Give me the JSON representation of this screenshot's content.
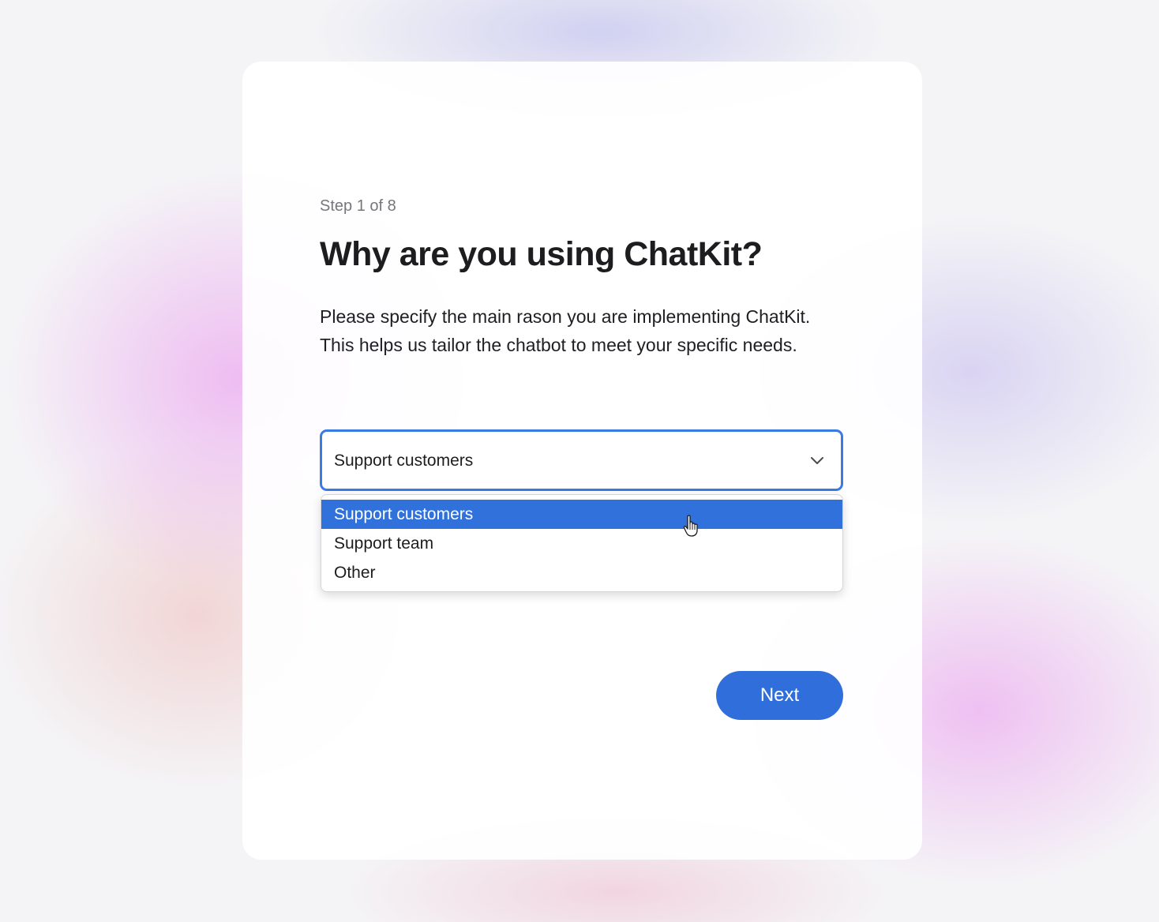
{
  "wizard": {
    "step_label": "Step 1 of 8",
    "title": "Why are you using ChatKit?",
    "description_line1": "Please specify the main rason you are implementing ChatKit.",
    "description_line2": "This helps us tailor the chatbot to meet your specific needs."
  },
  "reason_select": {
    "selected_value": "Support customers",
    "expanded_icon": "chevron-down-icon",
    "options": [
      {
        "label": "Support customers",
        "highlighted": true
      },
      {
        "label": "Support team",
        "highlighted": false
      },
      {
        "label": "Other",
        "highlighted": false
      }
    ]
  },
  "actions": {
    "next_label": "Next"
  },
  "colors": {
    "accent": "#306fdb",
    "focus_border": "#3a7ae3",
    "highlight": "#3171dc",
    "title_text": "#1d1d20",
    "muted_text": "#77767c"
  },
  "pointer_icon": "hand-pointer-icon"
}
